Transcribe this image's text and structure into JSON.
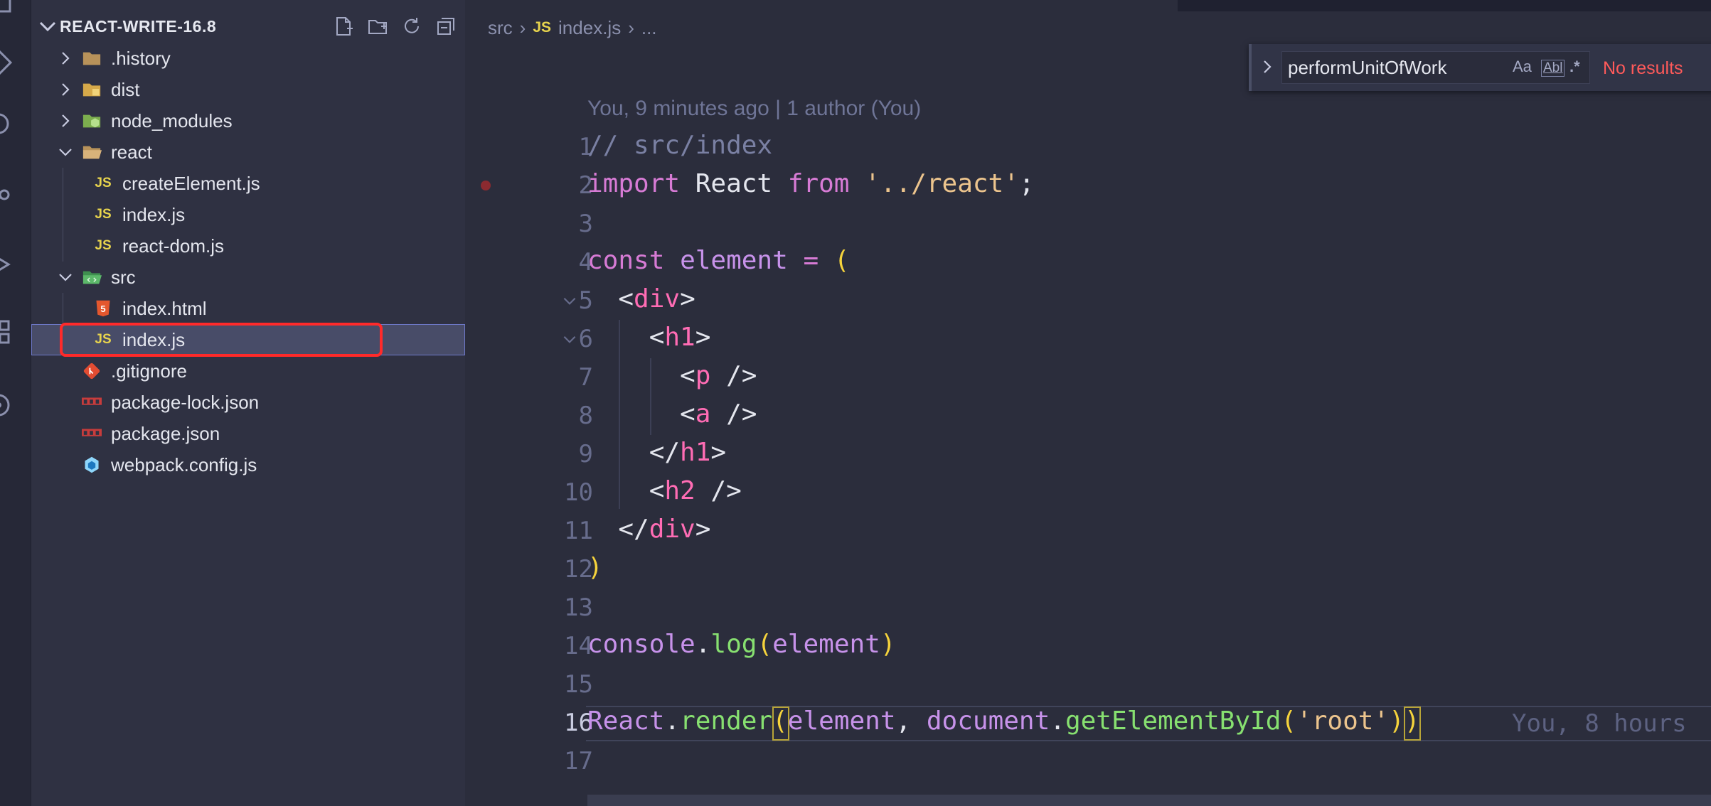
{
  "explorer": {
    "title": "REACT-WRITE-16.8",
    "actions": [
      "new-file-icon",
      "new-folder-icon",
      "refresh-icon",
      "collapse-all-icon"
    ],
    "items": [
      {
        "label": ".history",
        "type": "folder",
        "expanded": false
      },
      {
        "label": "dist",
        "type": "folder",
        "expanded": false
      },
      {
        "label": "node_modules",
        "type": "folder",
        "expanded": false
      },
      {
        "label": "react",
        "type": "folder",
        "expanded": true
      },
      {
        "label": "createElement.js",
        "type": "js"
      },
      {
        "label": "index.js",
        "type": "js"
      },
      {
        "label": "react-dom.js",
        "type": "js"
      },
      {
        "label": "src",
        "type": "folder",
        "expanded": true
      },
      {
        "label": "index.html",
        "type": "html"
      },
      {
        "label": "index.js",
        "type": "js",
        "selected": true
      },
      {
        "label": ".gitignore",
        "type": "git"
      },
      {
        "label": "package-lock.json",
        "type": "npm"
      },
      {
        "label": "package.json",
        "type": "npm"
      },
      {
        "label": "webpack.config.js",
        "type": "webpack"
      }
    ]
  },
  "breadcrumb": {
    "segments": [
      "src",
      "index.js",
      "..."
    ],
    "file_badge": "JS"
  },
  "find": {
    "query": "performUnitOfWork",
    "match_case": "Aa",
    "whole_word": "Abl",
    "regex": ".*",
    "status": "No results"
  },
  "editor": {
    "blame_header": "You, 9 minutes ago | 1 author (You)",
    "inline_blame": "You, 8 hours",
    "active_line": 16,
    "line_numbers": [
      "1",
      "2",
      "3",
      "4",
      "5",
      "6",
      "7",
      "8",
      "9",
      "10",
      "11",
      "12",
      "13",
      "14",
      "15",
      "16",
      "17"
    ]
  },
  "colors": {
    "keyword": "#d77bd5",
    "string": "#ecc48d",
    "tag": "#ff6cb4",
    "function": "#87e070",
    "highlight_box": "#ff2a2a"
  }
}
